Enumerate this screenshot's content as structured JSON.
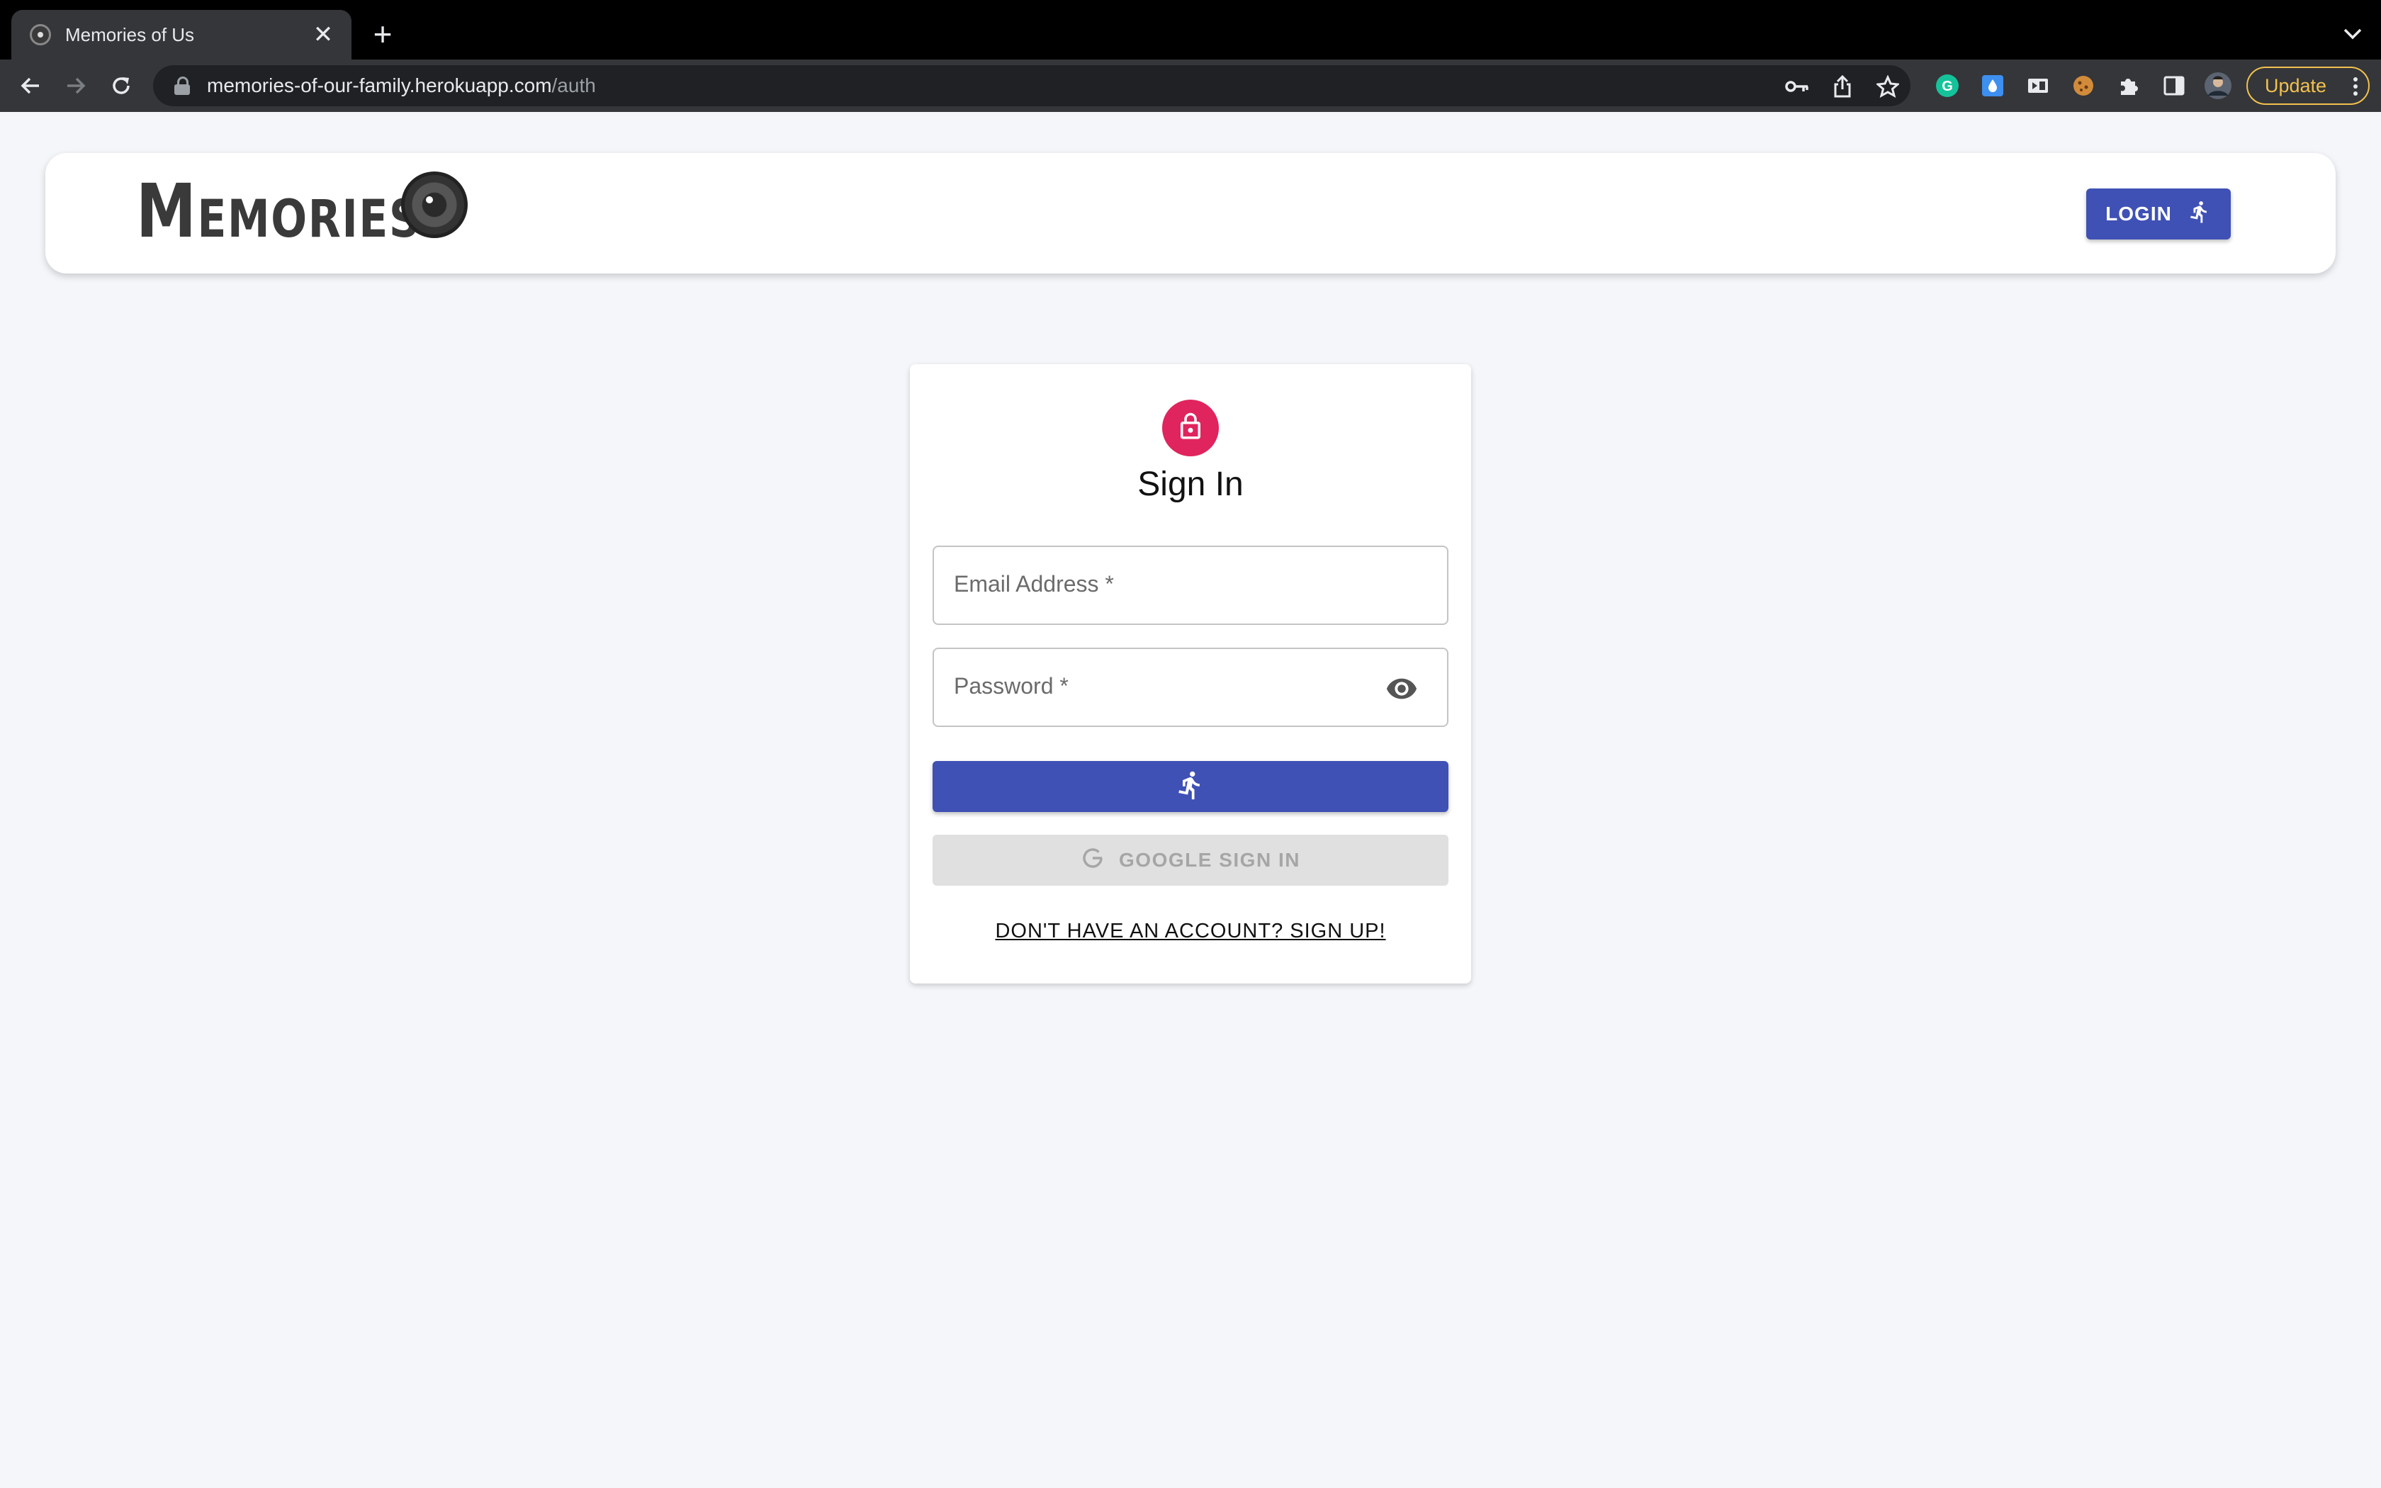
{
  "browser": {
    "tab_title": "Memories of Us",
    "tab_close": "✕",
    "new_tab": "+",
    "url_host": "memories-of-our-family.herokuapp.com",
    "url_path": "/auth",
    "update_label": "Update"
  },
  "header": {
    "brand": "Memories",
    "login_label": "LOGIN"
  },
  "signin": {
    "title": "Sign In",
    "email_label": "Email Address *",
    "password_label": "Password *",
    "google_label": "GOOGLE SIGN IN",
    "signup_link": "DON'T HAVE AN ACCOUNT? SIGN UP!"
  },
  "icons": {
    "favicon": "memories-camera-icon",
    "lock": "lock-icon",
    "eye": "visibility-icon",
    "run": "directions-run-icon",
    "google": "google-g-icon"
  },
  "colors": {
    "primary": "#3f51b5",
    "avatar": "#e0245e",
    "background": "#f4f6fa",
    "update_accent": "#f2c14e"
  }
}
